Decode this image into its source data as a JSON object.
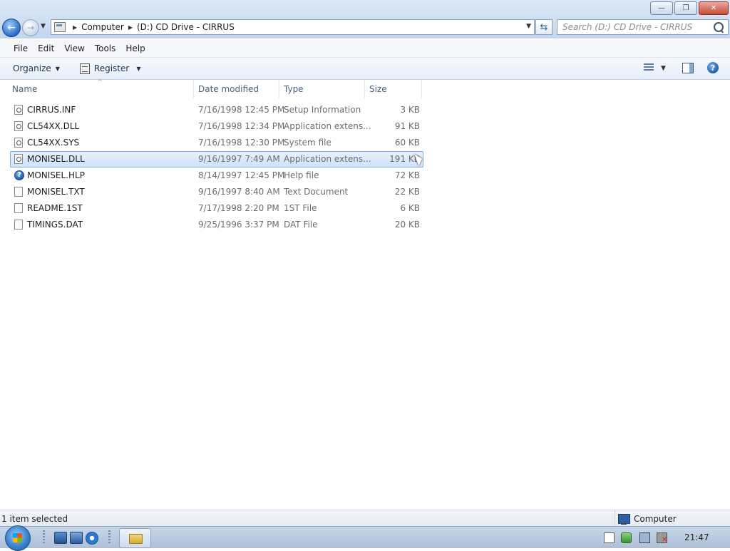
{
  "window": {
    "buttons": {
      "minimize": "—",
      "maximize": "❐",
      "close": "✕"
    }
  },
  "address": {
    "crumbs": [
      "Computer",
      "(D:) CD Drive - CIRRUS"
    ],
    "search_placeholder": "Search (D:) CD Drive - CIRRUS"
  },
  "menu": [
    "File",
    "Edit",
    "View",
    "Tools",
    "Help"
  ],
  "commands": {
    "organize": "Organize",
    "register": "Register"
  },
  "columns": {
    "name": "Name",
    "date": "Date modified",
    "type": "Type",
    "size": "Size"
  },
  "files": [
    {
      "name": "CIRRUS.INF",
      "date": "7/16/1998 12:45 PM",
      "type": "Setup Information",
      "size": "3 KB",
      "icon": "settings-file-icon",
      "selected": false
    },
    {
      "name": "CL54XX.DLL",
      "date": "7/16/1998 12:34 PM",
      "type": "Application extens...",
      "size": "91 KB",
      "icon": "dll-file-icon",
      "selected": false
    },
    {
      "name": "CL54XX.SYS",
      "date": "7/16/1998 12:30 PM",
      "type": "System file",
      "size": "60 KB",
      "icon": "system-file-icon",
      "selected": false
    },
    {
      "name": "MONISEL.DLL",
      "date": "9/16/1997 7:49 AM",
      "type": "Application extens...",
      "size": "191 KB",
      "icon": "dll-file-icon",
      "selected": true
    },
    {
      "name": "MONISEL.HLP",
      "date": "8/14/1997 12:45 PM",
      "type": "Help file",
      "size": "72 KB",
      "icon": "help-file-icon",
      "selected": false
    },
    {
      "name": "MONISEL.TXT",
      "date": "9/16/1997 8:40 AM",
      "type": "Text Document",
      "size": "22 KB",
      "icon": "text-file-icon",
      "selected": false
    },
    {
      "name": "README.1ST",
      "date": "7/17/1998 2:20 PM",
      "type": "1ST File",
      "size": "6 KB",
      "icon": "generic-file-icon",
      "selected": false
    },
    {
      "name": "TIMINGS.DAT",
      "date": "9/25/1996 3:37 PM",
      "type": "DAT File",
      "size": "20 KB",
      "icon": "generic-file-icon",
      "selected": false
    }
  ],
  "status": {
    "selection": "1 item selected",
    "location": "Computer"
  },
  "taskbar": {
    "clock": "21:47"
  },
  "colors": {
    "selection_bg": "#cfe3fb",
    "selection_border": "#84acdd",
    "accent": "#1e59a8"
  }
}
